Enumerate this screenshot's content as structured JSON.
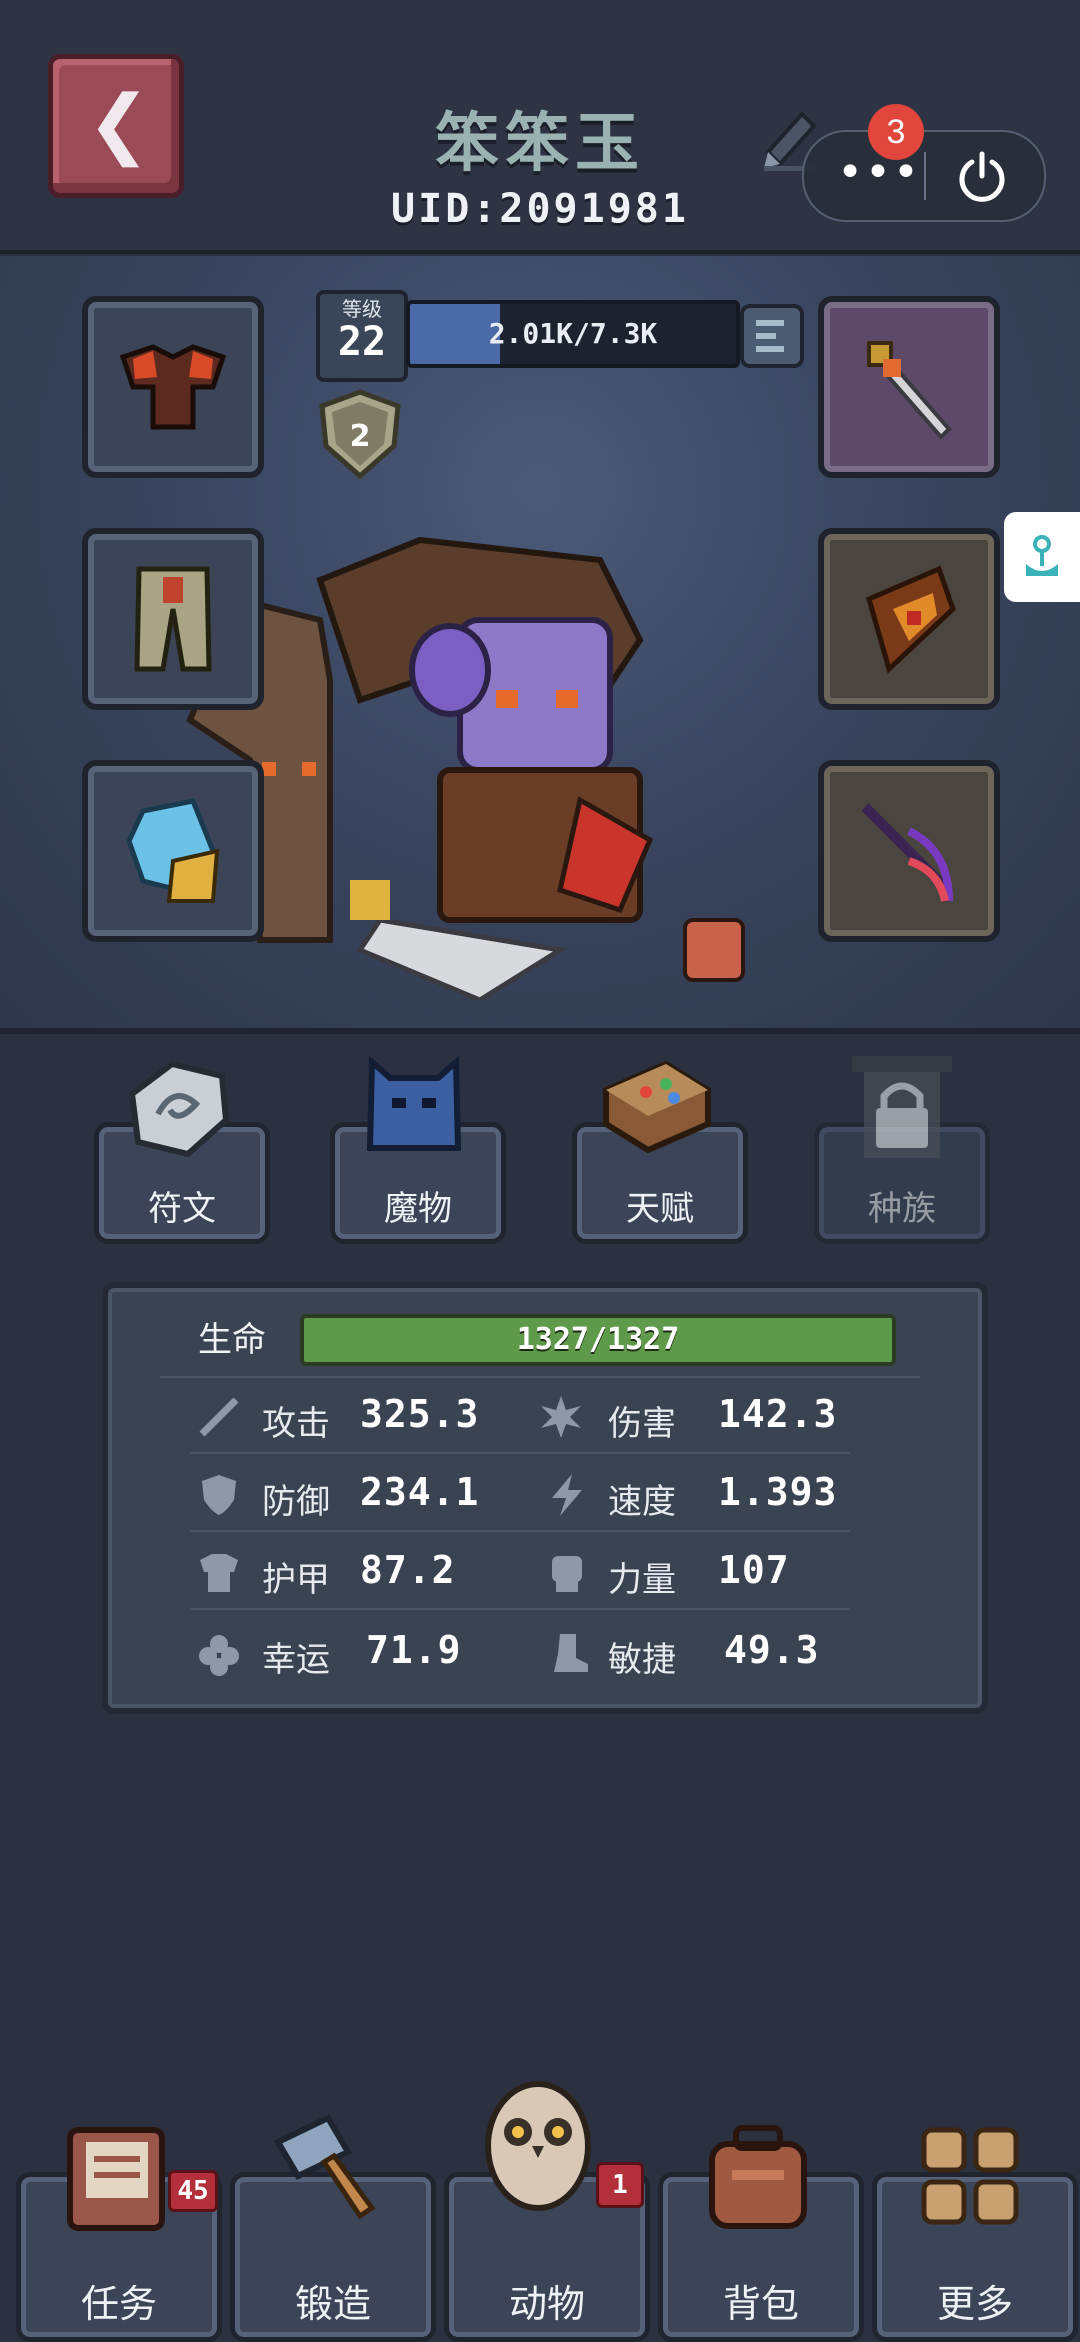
{
  "header": {
    "title": "笨笨玉",
    "uid": "UID:2091981",
    "notification_count": "3"
  },
  "colors": {
    "accent": "#4b6aa8",
    "hp": "#5e9a4a",
    "badge": "#e2453c"
  },
  "character": {
    "level_caption": "等级",
    "level": "22",
    "xp_text": "2.01K/7.3K",
    "xp_fraction": 0.275,
    "rank": "2"
  },
  "equipment_slots": [
    {
      "name": "armor-icon"
    },
    {
      "name": "sword-icon"
    },
    {
      "name": "pants-icon"
    },
    {
      "name": "shield-icon"
    },
    {
      "name": "crystal-icon"
    },
    {
      "name": "crossbow-icon"
    }
  ],
  "functions": [
    {
      "label": "符文",
      "icon": "rune-stone-icon",
      "locked": false
    },
    {
      "label": "魔物",
      "icon": "monster-icon",
      "locked": false
    },
    {
      "label": "天赋",
      "icon": "talent-book-icon",
      "locked": false
    },
    {
      "label": "种族",
      "icon": "lock-icon",
      "locked": true
    }
  ],
  "stats": {
    "hp_label": "生命",
    "hp_text": "1327/1327",
    "rows": [
      {
        "name": "攻击",
        "value": "325.3",
        "icon": "sword-icon"
      },
      {
        "name": "伤害",
        "value": "142.3",
        "icon": "burst-icon"
      },
      {
        "name": "防御",
        "value": "234.1",
        "icon": "shield-icon"
      },
      {
        "name": "速度",
        "value": "1.393",
        "icon": "lightning-icon"
      },
      {
        "name": "护甲",
        "value": "87.2",
        "icon": "armor-icon"
      },
      {
        "name": "力量",
        "value": "107",
        "icon": "fist-icon"
      },
      {
        "name": "幸运",
        "value": "71.9",
        "icon": "clover-icon"
      },
      {
        "name": "敏捷",
        "value": "49.3",
        "icon": "boot-icon"
      }
    ]
  },
  "bottom_nav": [
    {
      "label": "任务",
      "badge": "45"
    },
    {
      "label": "锻造",
      "badge": ""
    },
    {
      "label": "动物",
      "badge": "1"
    },
    {
      "label": "背包",
      "badge": ""
    },
    {
      "label": "更多",
      "badge": ""
    }
  ]
}
